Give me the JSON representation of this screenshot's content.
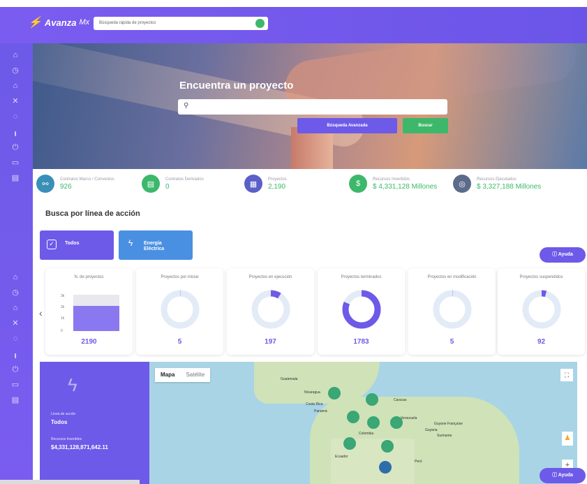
{
  "header": {
    "logo_text": "Avanza",
    "logo_suffix": "Mx",
    "search_placeholder": "Búsqueda rápida de proyectos"
  },
  "hero": {
    "title": "Encuentra un proyecto",
    "search_icon": "search-icon",
    "advanced_button": "Búsqueda Avanzada",
    "search_button": "Buscar"
  },
  "stats": [
    {
      "label": "Contratos Marco / Convenios",
      "value": "926",
      "color": "#3a8fb7",
      "icon": "handshake-icon"
    },
    {
      "label": "Contratos Derivados",
      "value": "0",
      "color": "#3db86b",
      "icon": "document-icon"
    },
    {
      "label": "Proyectos",
      "value": "2,190",
      "color": "#5b5fc7",
      "icon": "building-icon"
    },
    {
      "label": "Recursos Invertidos",
      "value": "$ 4,331,128 Millones",
      "color": "#3db86b",
      "icon": "money-icon"
    },
    {
      "label": "Recursos Ejecutados",
      "value": "$ 3,327,188 Millones",
      "color": "#5b6b8a",
      "icon": "coins-icon"
    }
  ],
  "section_title": "Busca por línea de acción",
  "categories": [
    {
      "label": "Todos",
      "icon": "check-square-icon"
    },
    {
      "label": "Energía Eléctrica",
      "icon": "lightning-icon"
    }
  ],
  "help_label": "Ayuda",
  "cards": [
    {
      "title": "N. de proyectos",
      "value": "2190",
      "fill": 1.0
    },
    {
      "title": "Proyectos por iniciar",
      "value": "5",
      "fill": 0.002
    },
    {
      "title": "Proyectos en ejecución",
      "value": "197",
      "fill": 0.09
    },
    {
      "title": "Proyectos terminados",
      "value": "1783",
      "fill": 0.814
    },
    {
      "title": "Proyectos en modificación",
      "value": "5",
      "fill": 0.002
    },
    {
      "title": "Proyectos suspendidos",
      "value": "92",
      "fill": 0.042
    }
  ],
  "bar_ticks": [
    "3k",
    "2k",
    "1k",
    "0"
  ],
  "bottom_panel": {
    "line_label": "Línea de acción",
    "line_value": "Todos",
    "resources_label": "Recursos Invertidos",
    "resources_value": "$4,331,128,871,642.11"
  },
  "map": {
    "tab_map": "Mapa",
    "tab_satellite": "Satélite",
    "labels": [
      "Guatemala",
      "Nicaragua",
      "Costa Rica",
      "Panamá",
      "Colombia",
      "Ecuador",
      "Guyana",
      "Suriname",
      "Guyane Française",
      "Caracas",
      "Venezuela",
      "Perú"
    ]
  },
  "colors": {
    "primary": "#6d5ae8",
    "green": "#3db86b",
    "blue": "#4a90e2"
  }
}
